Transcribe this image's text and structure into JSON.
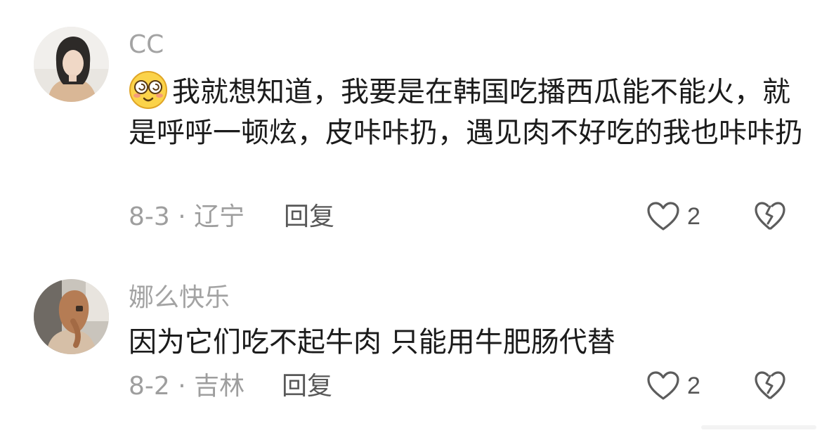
{
  "comments": [
    {
      "username": "CC",
      "emoji": "dizzy-face-emoji",
      "text": "我就想知道，我要是在韩国吃播西瓜能不能火，就是呼呼一顿炫，皮咔咔扔，遇见肉不好吃的我也咔咔扔",
      "meta": "8-3 · 辽宁",
      "reply_label": "回复",
      "likes": "2"
    },
    {
      "username": "娜么快乐",
      "text": "因为它们吃不起牛肉 只能用牛肥肠代替",
      "meta": "8-2 · 吉林",
      "reply_label": "回复",
      "likes": "2"
    }
  ],
  "colors": {
    "username": "#a3a3a3",
    "body_text": "#1b1b1b",
    "meta": "#9e9e9e",
    "reply": "#585858",
    "icon_stroke": "#5c5c5c"
  }
}
